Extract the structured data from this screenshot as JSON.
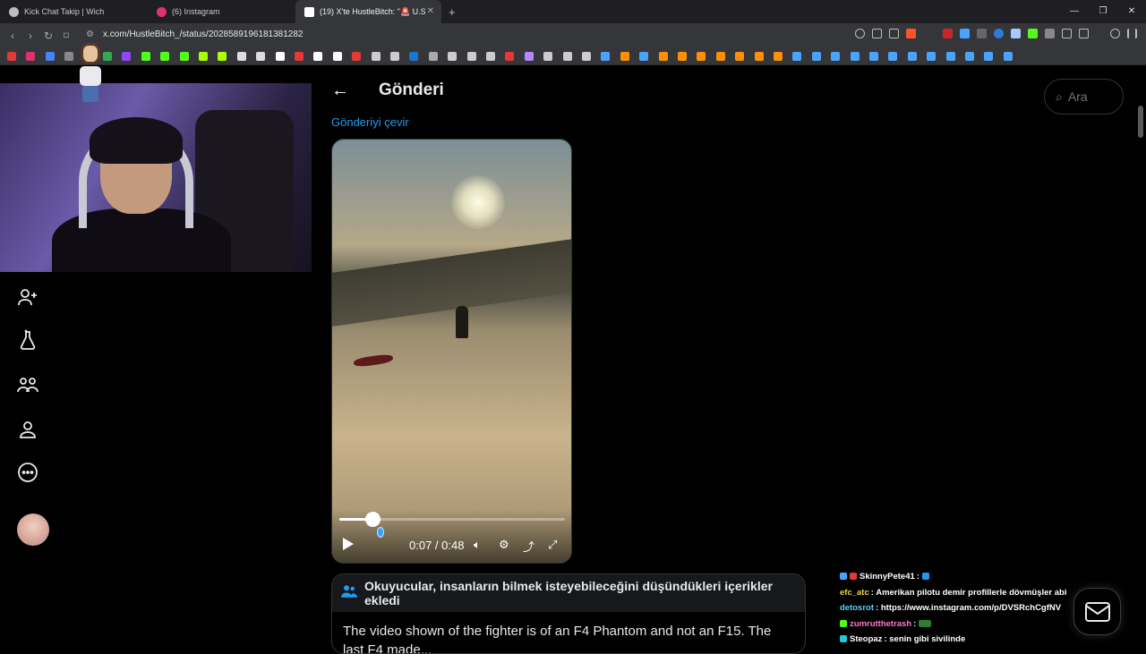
{
  "tabs": [
    {
      "title": "Kick Chat Takip | Wich",
      "favicon_color": "#bdbdbd"
    },
    {
      "title": "(6) Instagram",
      "favicon_color": "#e1306c"
    },
    {
      "title": "(19) X'te HustleBitch: \"🚨 U.S",
      "favicon_color": "#ffffff",
      "active": true
    }
  ],
  "url": "x.com/HustleBitch_/status/2028589196181381282",
  "page": {
    "title": "Gönderi",
    "search_placeholder": "Ara",
    "translate_link": "Gönderiyi çevir"
  },
  "video": {
    "current_time": "0:07",
    "duration": "0:48",
    "time_display": "0:07 / 0:48",
    "progress_fraction": 0.146
  },
  "community_note": {
    "title": "Okuyucular, insanların bilmek isteyebileceğini düşündükleri içerikler ekledi",
    "body": "The video shown of the fighter is of an F4 Phantom and not an F15. The last F4 made..."
  },
  "chat": [
    {
      "user": "SkinnyPete41",
      "message": "",
      "color": "#ffffff"
    },
    {
      "user": "efc_atc",
      "message": "Amerikan pilotu demir profillerle dövmüşler abi",
      "color": "#f2d24b"
    },
    {
      "user": "detosrot",
      "message": "https://www.instagram.com/p/DVSRchCgfNV",
      "color": "#56d4ff"
    },
    {
      "user": "zumrutthetrash",
      "message": "",
      "color": "#ff79c6"
    },
    {
      "user": "Steopaz",
      "message": "senin gibi sivilinde",
      "color": "#ffffff"
    }
  ],
  "colors": {
    "accent": "#1d9bf0",
    "background": "#000000",
    "border": "#2f3336"
  }
}
